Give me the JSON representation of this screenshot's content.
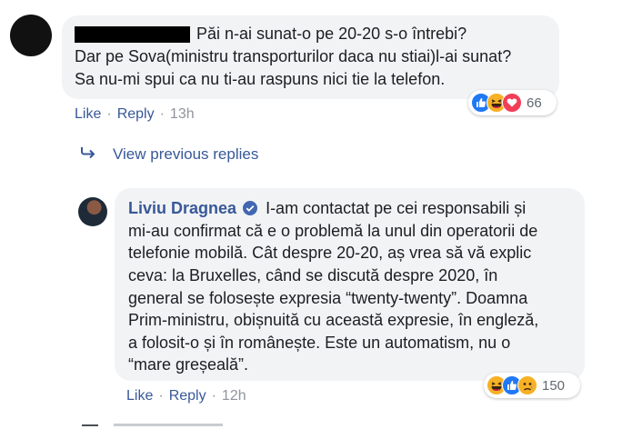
{
  "comment1": {
    "line1": "Păi n-ai sunat-o pe 20-20 s-o întrebi?",
    "line2": "Dar pe Sova(ministru transporturilor daca nu stiai)l-ai sunat?",
    "line3": "Sa nu-mi spui ca nu ti-au raspuns nici tie la telefon.",
    "actions": {
      "like": "Like",
      "reply": "Reply",
      "time": "13h"
    },
    "reactions": {
      "icons": [
        "like-icon",
        "haha-icon",
        "love-icon"
      ],
      "count": "66"
    }
  },
  "view_previous": "View previous replies",
  "reply": {
    "author": "Liviu Dragnea",
    "lines": [
      "I-am contactat pe cei responsabili și",
      "mi-au confirmat că e o problemă la unul din operatorii de",
      "telefonie mobilă. Cât despre 20-20, aș vrea să vă explic",
      "ceva: la Bruxelles, când se discută despre 2020, în",
      "general se folosește expresia “twenty-twenty”. Doamna",
      "Prim-ministru, obișnuită cu această expresie, în engleză,",
      "a folosit-o și în românește. Este un automatism, nu o",
      "“mare greșeală”."
    ],
    "actions": {
      "like": "Like",
      "reply": "Reply",
      "time": "12h"
    },
    "reactions": {
      "icons": [
        "haha-icon",
        "like-icon",
        "sad-icon"
      ],
      "count": "150"
    }
  },
  "colors": {
    "link": "#385898",
    "bubble": "#f2f3f5",
    "like": "#2078f4",
    "love": "#f33e58",
    "haha": "#f7b125"
  }
}
